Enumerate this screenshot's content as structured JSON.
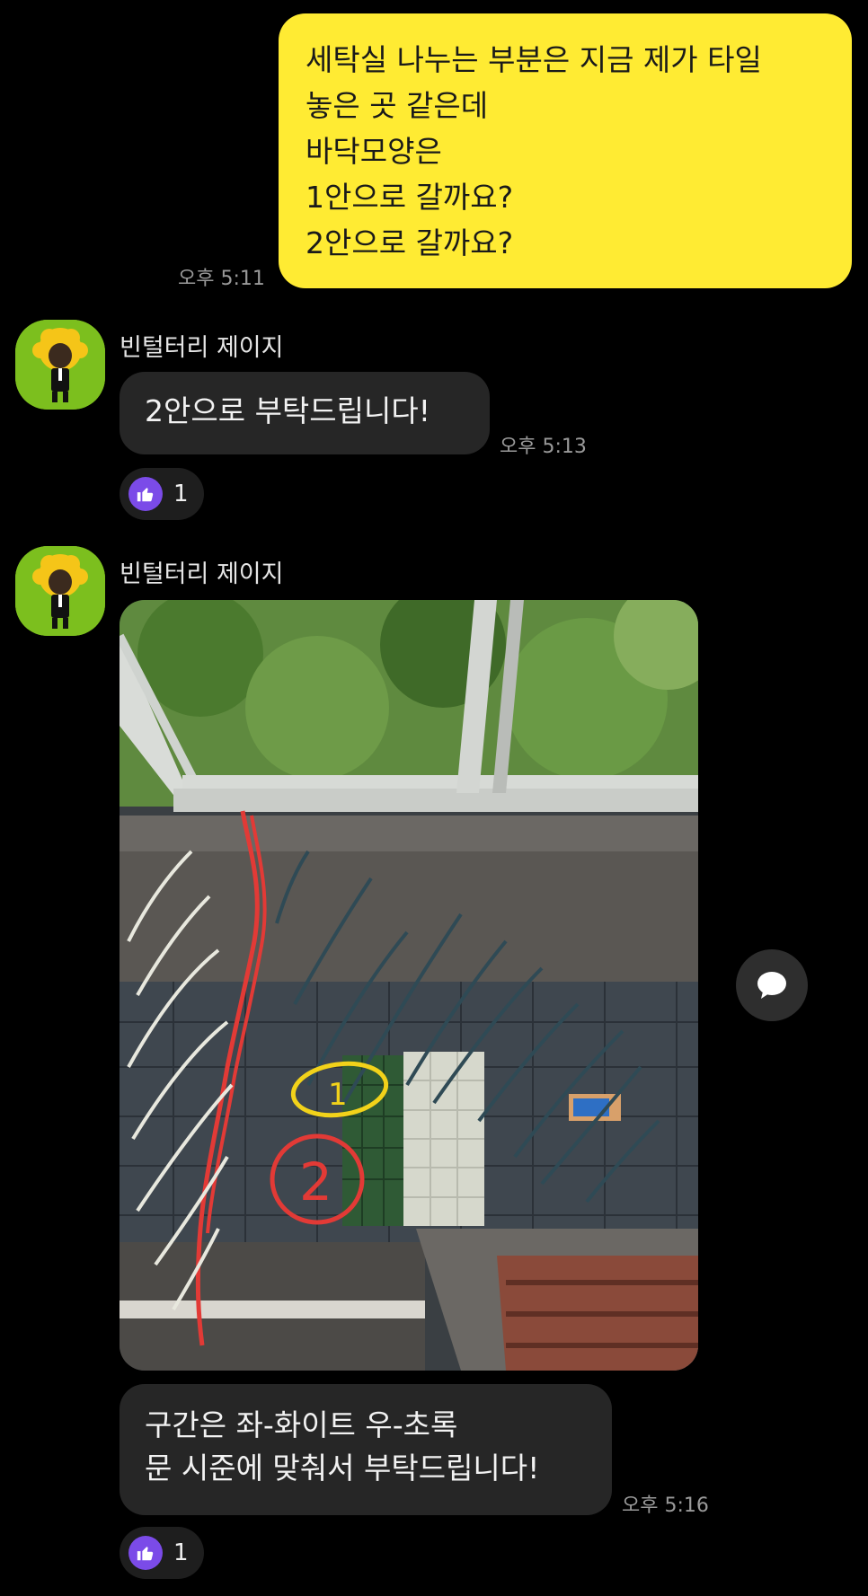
{
  "messages": {
    "outgoing": {
      "lines": [
        "세탁실 나누는 부분은 지금 제가 타일",
        "놓은 곳 같은데",
        "바닥모양은",
        "1안으로 갈까요?",
        "2안으로 갈까요?"
      ],
      "time": "오후 5:11"
    },
    "reply1": {
      "sender": "빈털터리 제이지",
      "text": "2안으로 부탁드립니다!",
      "time": "오후 5:13",
      "reaction": {
        "icon": "thumbs-up-icon",
        "count": "1"
      }
    },
    "reply2": {
      "sender": "빈털터리 제이지",
      "photo_annotations": [
        "1",
        "2"
      ],
      "lines": [
        "구간은 좌-화이트 우-초록",
        "문 시준에 맞춰서 부탁드립니다!"
      ],
      "time": "오후 5:16",
      "reaction": {
        "icon": "thumbs-up-icon",
        "count": "1"
      }
    }
  },
  "colors": {
    "outgoing_bubble": "#FFEB33",
    "incoming_bubble": "#262626",
    "background": "#000000",
    "reaction_badge": "#7B4BE8",
    "avatar_bg": "#7CBF1E"
  }
}
